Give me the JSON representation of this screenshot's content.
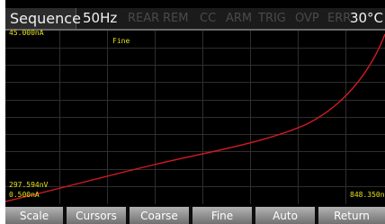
{
  "status": {
    "mode": "Sequence",
    "frequency": "50Hz",
    "indicators": [
      "REAR",
      "REM",
      "CC",
      "ARM",
      "TRIG",
      "OVP",
      "ERR"
    ],
    "temperature": "30°C"
  },
  "plot": {
    "y_top_label": "45.000nA",
    "mode_label": "Fine",
    "y_bottom_voltage": "297.594nV",
    "y_bottom_current": "0.500nA",
    "x_right_label": "848.350n",
    "trace_color": "#d41b22",
    "label_color": "#e6e01a"
  },
  "softkeys": [
    "Scale",
    "Cursors",
    "Coarse",
    "Fine",
    "Auto",
    "Return"
  ]
}
